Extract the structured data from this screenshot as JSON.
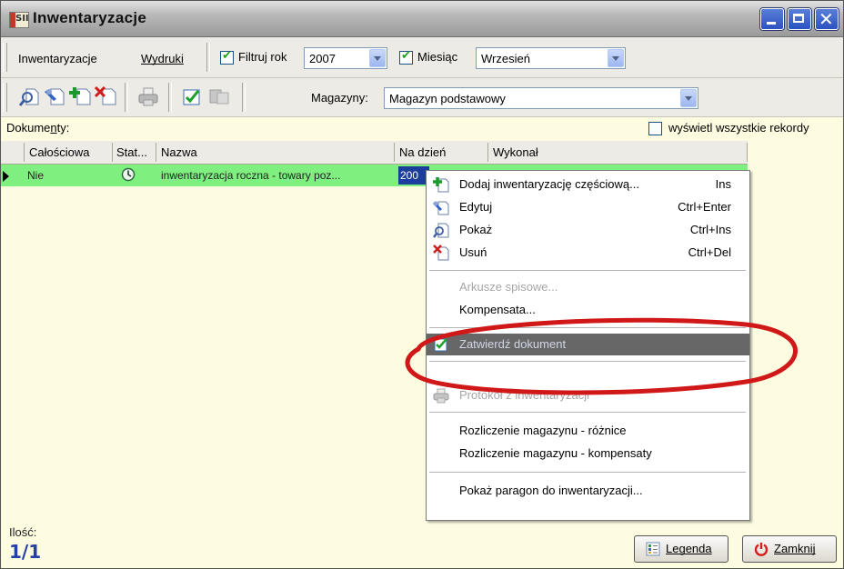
{
  "window": {
    "title": "Inwentaryzacje",
    "app_icon_text": "SII",
    "title_bar_color": "#a8a8a8",
    "caption_buttons": [
      "minimize-icon",
      "maximize-icon",
      "close-icon"
    ]
  },
  "toolbar1": {
    "menu": [
      "Inwentaryzacje",
      "Wydruki"
    ],
    "filter_year": {
      "checked": true,
      "label": "Filtruj rok",
      "value": "2007"
    },
    "filter_month": {
      "checked": true,
      "label": "Miesiąc",
      "value": "Wrzesień"
    }
  },
  "toolbar2": {
    "icons": [
      "show-icon",
      "edit-icon",
      "add-icon",
      "delete-icon",
      "print-icon",
      "approve-icon",
      "compensate-icon"
    ],
    "warehouse_label": "Magazyny:",
    "warehouse_value": "Magazyn podstawowy"
  },
  "documents": {
    "label": "Dokumenty:",
    "show_all_label": "wyświetl wszystkie rekordy",
    "show_all_checked": false,
    "columns": [
      "Całościowa",
      "Stat...",
      "Nazwa",
      "Na dzień",
      "Wykonał"
    ],
    "rows": [
      {
        "calosciowa": "Nie",
        "status_icon": "clock-icon",
        "nazwa": "inwentaryzacja roczna - towary poz...",
        "na_dzien": "200",
        "wykonal": ""
      }
    ],
    "selected_row_color": "#7ff07f",
    "background_color": "#fdfbe0"
  },
  "context_menu": {
    "items": [
      {
        "label": "Dodaj inwentaryzację częściową...",
        "shortcut": "Ins",
        "icon": "add-icon",
        "enabled": true
      },
      {
        "label": "Edytuj",
        "shortcut": "Ctrl+Enter",
        "icon": "edit-icon",
        "enabled": true
      },
      {
        "label": "Pokaż",
        "shortcut": "Ctrl+Ins",
        "icon": "show-icon",
        "enabled": true
      },
      {
        "label": "Usuń",
        "shortcut": "Ctrl+Del",
        "icon": "delete-icon",
        "enabled": true
      },
      {
        "label": "Arkusze spisowe...",
        "shortcut": "",
        "icon": "",
        "enabled": false
      },
      {
        "label": "Kompensata...",
        "shortcut": "",
        "icon": "",
        "enabled": true
      },
      {
        "label": "Zatwierdź dokument",
        "shortcut": "",
        "icon": "approve-icon",
        "enabled": true,
        "highlighted": true
      },
      {
        "label": "Protokół z inwentaryzacji",
        "shortcut": "",
        "icon": "print-icon",
        "enabled": false
      },
      {
        "label": "Rozliczenie magazynu - różnice",
        "shortcut": "",
        "icon": "",
        "enabled": true
      },
      {
        "label": "Rozliczenie magazynu - kompensaty",
        "shortcut": "",
        "icon": "",
        "enabled": true
      },
      {
        "label": "Pokaż paragon do inwentaryzacji...",
        "shortcut": "",
        "icon": "",
        "enabled": true
      }
    ],
    "highlight_color": "#676767",
    "annotation_color": "#d01818"
  },
  "footer": {
    "count_label": "Ilość:",
    "count_value": "1/1",
    "legend_label": "Legenda",
    "legend_icon": "legend-icon",
    "close_label": "Zamknij",
    "close_icon": "power-icon"
  }
}
